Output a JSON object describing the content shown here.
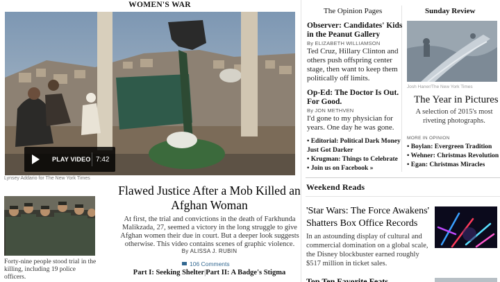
{
  "lead": {
    "kicker": "WOMEN'S WAR",
    "photo_credit": "Lynsey Addario for The New York Times",
    "video": {
      "play_label": "PLAY VIDEO",
      "duration": "7:42"
    },
    "headline": "Flawed Justice After a Mob Killed an Afghan Woman",
    "summary": "At first, the trial and convictions in the death of Farkhunda Malikzada, 27, seemed a victory in the long struggle to give Afghan women their due in court. But a deeper look suggests otherwise. This video contains scenes of graphic violence.",
    "byline": "By ALISSA J. RUBIN",
    "comments": "106 Comments",
    "part1": "Part I: Seeking Shelter",
    "part_divider": "|",
    "part2": "Part II: A Badge's Stigma",
    "thumb_caption": "Forty-nine people stood trial in the killing, including 19 police officers."
  },
  "opinion": {
    "section_title": "The Opinion Pages",
    "items": [
      {
        "headline": "Observer: Candidates' Kids in the Peanut Gallery",
        "byline": "By ELIZABETH WILLIAMSON",
        "body": "Ted Cruz, Hillary Clinton and others push offspring center stage, then want to keep them politically off limits."
      },
      {
        "headline": "Op-Ed: The Doctor Is Out. For Good.",
        "byline": "By JON METHVEN",
        "body": "I'd gone to my physician for years. One day he was gone."
      }
    ],
    "links": [
      "Editorial: Political Dark Money Just Got Darker",
      "Krugman: Things to Celebrate",
      "Join us on Facebook »"
    ]
  },
  "sunday_review": {
    "section_title": "Sunday Review",
    "image_credit": "Josh Haner/The New York Times",
    "headline": "The Year in Pictures",
    "subhead": "A selection of 2015's most riveting photographs.",
    "more_label": "MORE IN OPINION",
    "more_links": [
      "Boylan: Evergreen Tradition",
      "Wehner: Christmas Revolution",
      "Egan: Christmas Miracles"
    ]
  },
  "weekend_reads": {
    "section_title": "Weekend Reads",
    "headline": "'Star Wars: The Force Awakens' Shatters Box Office Records",
    "body": "In an astounding display of cultural and commercial domination on a global scale, the Disney blockbuster earned roughly $517 million in ticket sales.",
    "next_headline": "Top Ten Favorite Feats"
  },
  "colors": {
    "link_blue": "#326891",
    "rule_gray": "#e2e2e2"
  }
}
